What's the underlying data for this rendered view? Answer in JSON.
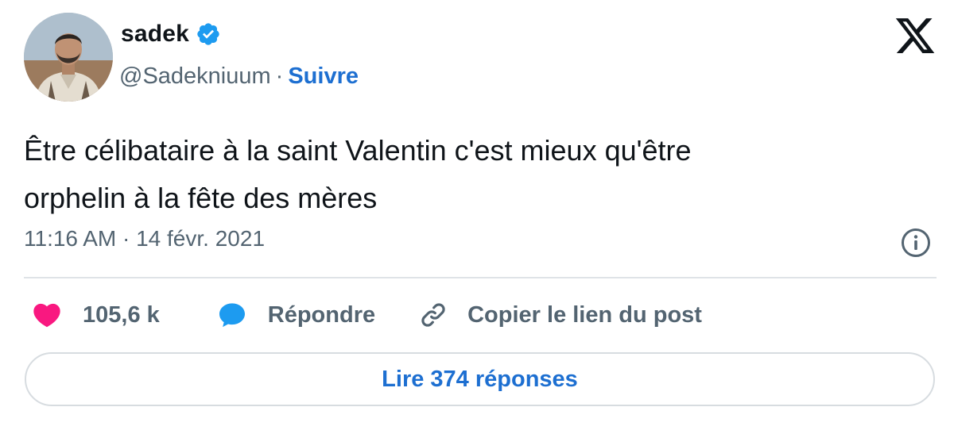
{
  "author": {
    "name": "sadek",
    "handle": "@Sadekniuum",
    "separator": "·",
    "follow_label": "Suivre",
    "verified_icon": "verified-badge-icon",
    "avatar_icon": "profile-photo"
  },
  "brand": {
    "logo_icon": "x-logo-icon"
  },
  "tweet": {
    "text_line1": "Être célibataire à la saint Valentin c'est mieux qu'être",
    "text_line2": "orphelin à la fête des mères",
    "timestamp": "11:16 AM · 14 févr. 2021"
  },
  "actions": {
    "likes_count": "105,6 k",
    "reply_label": "Répondre",
    "copy_link_label": "Copier le lien du post"
  },
  "footer": {
    "read_replies_label": "Lire 374 réponses"
  },
  "colors": {
    "accent_blue": "#1d6fd1",
    "verified_blue": "#1d9bf0",
    "like_pink": "#f91880",
    "secondary_text": "#536471",
    "primary_text": "#0f1419"
  }
}
